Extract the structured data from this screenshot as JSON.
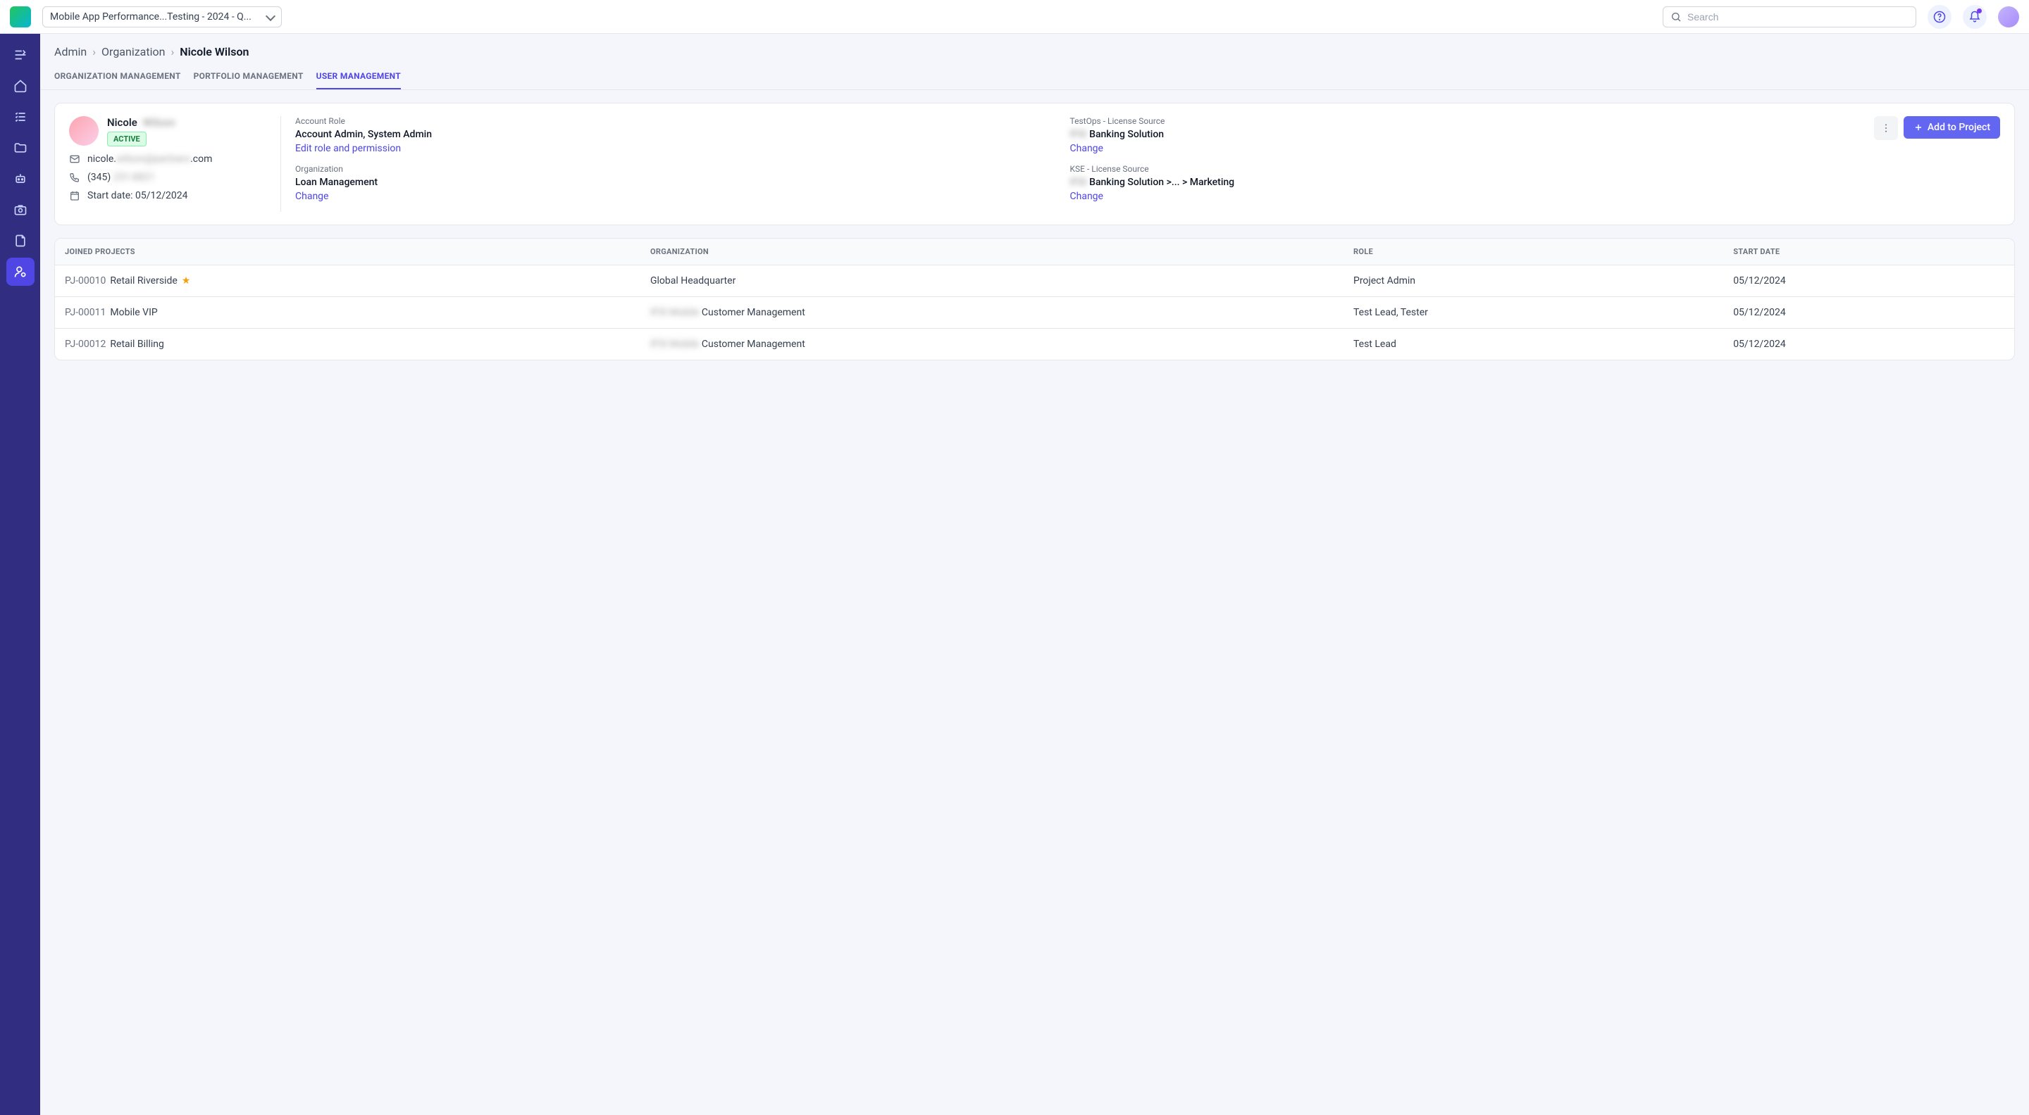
{
  "topbar": {
    "project_selector": "Mobile App Performance...Testing - 2024 - Q...",
    "search_placeholder": "Search"
  },
  "breadcrumbs": {
    "level1": "Admin",
    "level2": "Organization",
    "current": "Nicole Wilson"
  },
  "tabs": {
    "org": "ORGANIZATION MANAGEMENT",
    "portfolio": "PORTFOLIO MANAGEMENT",
    "user": "USER MANAGEMENT"
  },
  "user": {
    "first_name": "Nicole",
    "last_name_blur": "Wilson",
    "status": "ACTIVE",
    "email_prefix": "nicole.",
    "email_blur": "wilson@partners",
    "email_suffix": ".com",
    "phone_prefix": "(345) ",
    "phone_blur": "231-8821",
    "start_date_label": "Start date: 05/12/2024",
    "account_role_label": "Account Role",
    "account_role_value": "Account Admin, System Admin",
    "edit_role_link": "Edit role and permission",
    "organization_label": "Organization",
    "organization_value": "Loan Management",
    "change_link": "Change",
    "testops_label": "TestOps - License Source",
    "testops_blur": "IFSI",
    "testops_value": " Banking Solution",
    "kse_label": "KSE - License Source",
    "kse_blur": "IFSI",
    "kse_value": " Banking Solution >... > Marketing",
    "add_to_project": "Add to Project"
  },
  "table": {
    "headers": {
      "joined": "JOINED PROJECTS",
      "org": "ORGANIZATION",
      "role": "ROLE",
      "start": "START DATE"
    },
    "rows": [
      {
        "id": "PJ-00010",
        "name": "Retail Riverside",
        "starred": true,
        "org_blur": "",
        "org": "Global Headquarter",
        "role": "Project Admin",
        "start": "05/12/2024"
      },
      {
        "id": "PJ-00011",
        "name": "Mobile VIP",
        "starred": false,
        "org_blur": "IFSI Mobile ",
        "org": "Customer Management",
        "role": "Test Lead, Tester",
        "start": "05/12/2024"
      },
      {
        "id": "PJ-00012",
        "name": "Retail Billing",
        "starred": false,
        "org_blur": "IFSI Mobile ",
        "org": "Customer Management",
        "role": "Test Lead",
        "start": "05/12/2024"
      }
    ]
  }
}
